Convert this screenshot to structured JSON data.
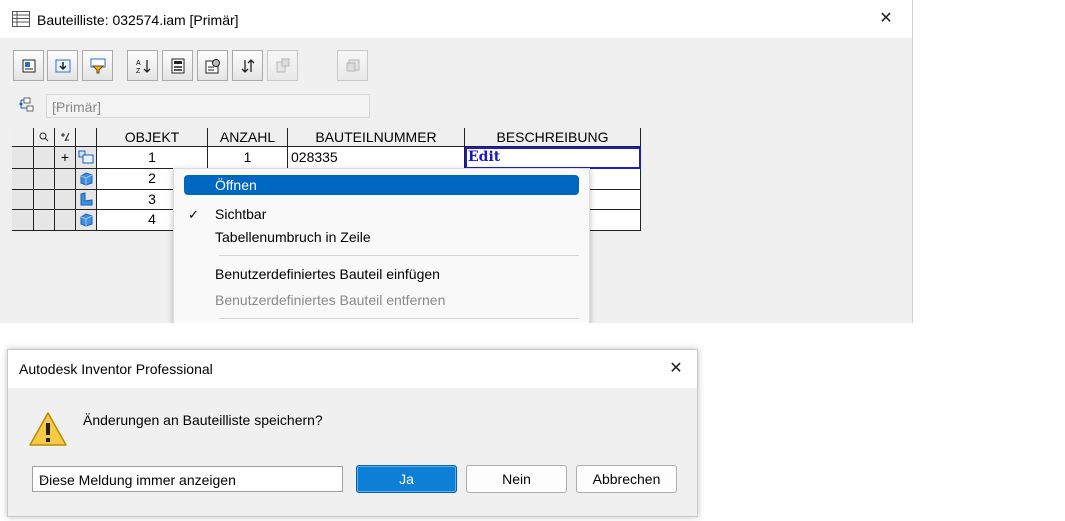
{
  "bom_window": {
    "title": "Bauteilliste: 032574.iam [Primär]",
    "close_glyph": "✕",
    "view_select": {
      "value": "[Primär]"
    },
    "toolbar_icons": [
      "bom-settings-icon",
      "export-icon",
      "filter-icon",
      "sort-icon",
      "renumber-icon",
      "properties-icon",
      "reorder-icon",
      "merge-icon",
      "copy-settings-icon"
    ],
    "table": {
      "columns": [
        "OBJEKT",
        "ANZAHL",
        "BAUTEILNUMMER",
        "BESCHREIBUNG"
      ],
      "rows": [
        {
          "expand": "+",
          "objekt": "1",
          "anzahl": "1",
          "bauteilnummer": "028335",
          "beschreibung": "Edit"
        },
        {
          "expand": "",
          "objekt": "2",
          "anzahl": "",
          "bauteilnummer": "",
          "beschreibung": ""
        },
        {
          "expand": "",
          "objekt": "3",
          "anzahl": "",
          "bauteilnummer": "",
          "beschreibung": ""
        },
        {
          "expand": "",
          "objekt": "4",
          "anzahl": "",
          "bauteilnummer": "",
          "beschreibung": ""
        }
      ]
    },
    "context_menu": {
      "items": [
        {
          "label": "Öffnen",
          "highlighted": true
        },
        {
          "label": "Sichtbar",
          "checked": true
        },
        {
          "label": "Tabellenumbruch in Zeile"
        },
        {
          "label": "Benutzerdefiniertes Bauteil einfügen"
        },
        {
          "label": "Benutzerdefiniertes Bauteil entfernen",
          "disabled": true
        }
      ]
    }
  },
  "dialog": {
    "title": "Autodesk Inventor Professional",
    "close_glyph": "✕",
    "message": "Änderungen an Bauteilliste speichern?",
    "option_select": "Diese Meldung immer anzeigen",
    "buttons": {
      "yes": "Ja",
      "no": "Nein",
      "cancel": "Abbrechen"
    }
  },
  "colors": {
    "accent": "#0067c0",
    "primary_button": "#0e7fd6",
    "edit_text": "#1818c8",
    "disabled_text": "#8a8a8a"
  }
}
